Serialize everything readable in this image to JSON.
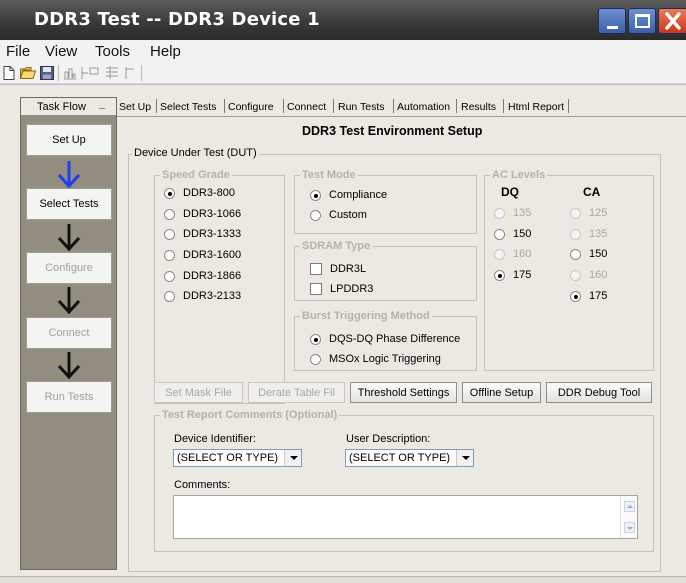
{
  "window": {
    "title": "DDR3 Test -- DDR3 Device 1"
  },
  "menu": [
    "File",
    "View",
    "Tools",
    "Help"
  ],
  "task_flow": {
    "header": "Task Flow",
    "minimize_glyph": "_",
    "steps": [
      "Set Up",
      "Select Tests",
      "Configure",
      "Connect",
      "Run Tests"
    ],
    "active_step": "Set Up"
  },
  "tabs": [
    "Set Up",
    "Select Tests",
    "Configure",
    "Connect",
    "Run Tests",
    "Automation",
    "Results",
    "Html Report"
  ],
  "heading": "DDR3 Test Environment Setup",
  "dut": {
    "legend": "Device Under Test (DUT)",
    "speed_grade": {
      "legend": "Speed Grade",
      "options": [
        "DDR3-800",
        "DDR3-1066",
        "DDR3-1333",
        "DDR3-1600",
        "DDR3-1866",
        "DDR3-2133"
      ],
      "selected": "DDR3-800"
    },
    "test_mode": {
      "legend": "Test Mode",
      "options": [
        "Compliance",
        "Custom"
      ],
      "selected": "Compliance"
    },
    "sdram_type": {
      "legend": "SDRAM Type",
      "options": [
        "DDR3L",
        "LPDDR3"
      ]
    },
    "burst_triggering": {
      "legend": "Burst Triggering Method",
      "options": [
        "DQS-DQ Phase Difference",
        "MSOx Logic Triggering"
      ],
      "selected": "DQS-DQ Phase Difference"
    },
    "ac_levels": {
      "legend": "AC Levels",
      "dq_header": "DQ",
      "ca_header": "CA",
      "dq_options": [
        "135",
        "150",
        "160",
        "175"
      ],
      "dq_selected": "175",
      "ca_options": [
        "125",
        "135",
        "150",
        "160",
        "175"
      ],
      "ca_selected": "175"
    }
  },
  "buttons": {
    "set_mask_file": "Set Mask File",
    "derate_table": "Derate Table Fil",
    "threshold_settings": "Threshold Settings",
    "offline_setup": "Offline Setup",
    "ddr_debug_tool": "DDR Debug Tool"
  },
  "report": {
    "legend": "Test Report Comments (Optional)",
    "device_identifier_label": "Device Identifier:",
    "device_identifier_value": "(SELECT OR TYPE)",
    "user_description_label": "User Description:",
    "user_description_value": "(SELECT OR TYPE)",
    "comments_label": "Comments:"
  },
  "colors": {
    "titlebar": "#3a3a3a",
    "taskpane": "#938d80",
    "arrow_active": "#1f3df0",
    "arrow_inactive": "#111111",
    "close_button": "#d9441f",
    "window_buttons": "#4a6fbf"
  },
  "icons": [
    "new-file-icon",
    "open-folder-icon",
    "save-icon",
    "toolbar-icon-4",
    "toolbar-icon-5",
    "toolbar-icon-6",
    "toolbar-icon-7"
  ]
}
